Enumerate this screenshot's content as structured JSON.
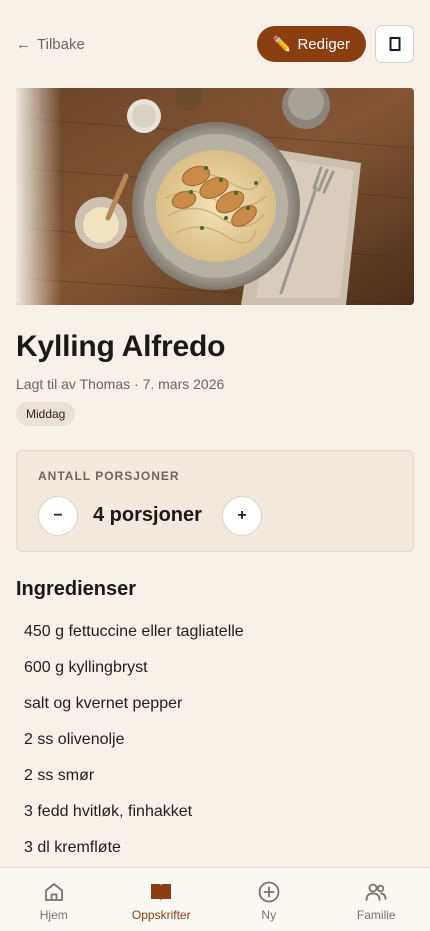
{
  "header": {
    "back_label": "Tilbake",
    "edit_label": "Rediger",
    "edit_icon": "pencil-icon",
    "bookmark_icon": "bookmark-icon"
  },
  "hero": {
    "image": "creamy-fettuccine-with-sliced-chicken-photo"
  },
  "recipe": {
    "title": "Kylling Alfredo",
    "meta": "Lagt til av Thomas · 7. mars 2026",
    "category": "Middag"
  },
  "portions": {
    "label": "ANTALL PORSJONER",
    "value": "4 porsjoner",
    "minus": "−",
    "plus": "+"
  },
  "ingredients": {
    "heading": "Ingredienser",
    "items": [
      "450 g fettuccine eller tagliatelle",
      "600 g kyllingbryst",
      "salt og kvernet pepper",
      "2 ss olivenolje",
      "2 ss smør",
      "3 fedd hvitløk, finhakket",
      "3 dl kremfløte"
    ]
  },
  "nav": {
    "items": [
      {
        "label": "Hjem",
        "icon": "home-icon",
        "active": false
      },
      {
        "label": "Oppskrifter",
        "icon": "book-icon",
        "active": true
      },
      {
        "label": "Ny",
        "icon": "plus-circle-icon",
        "active": false
      },
      {
        "label": "Familie",
        "icon": "users-icon",
        "active": false
      }
    ]
  },
  "colors": {
    "accent": "#8a3f12",
    "background": "#f8f1ea",
    "card": "#f3e9df"
  }
}
